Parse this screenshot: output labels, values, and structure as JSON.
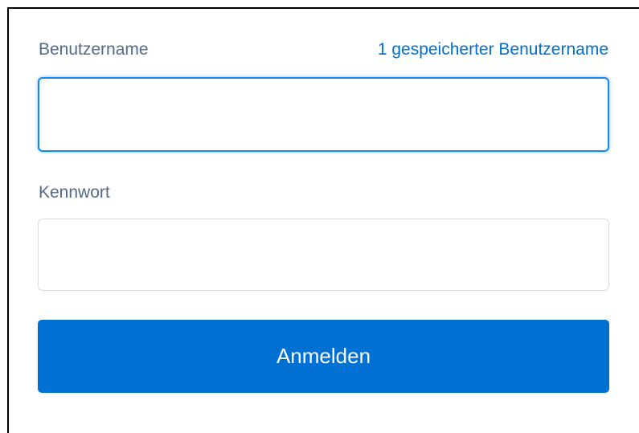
{
  "username": {
    "label": "Benutzername",
    "saved_link": "1 gespeicherter Benutzername",
    "value": "",
    "placeholder": ""
  },
  "password": {
    "label": "Kennwort",
    "value": "",
    "placeholder": ""
  },
  "login_button": {
    "label": "Anmelden"
  },
  "colors": {
    "accent": "#0070d2",
    "label": "#54698d",
    "focus_border": "#1589ee"
  }
}
